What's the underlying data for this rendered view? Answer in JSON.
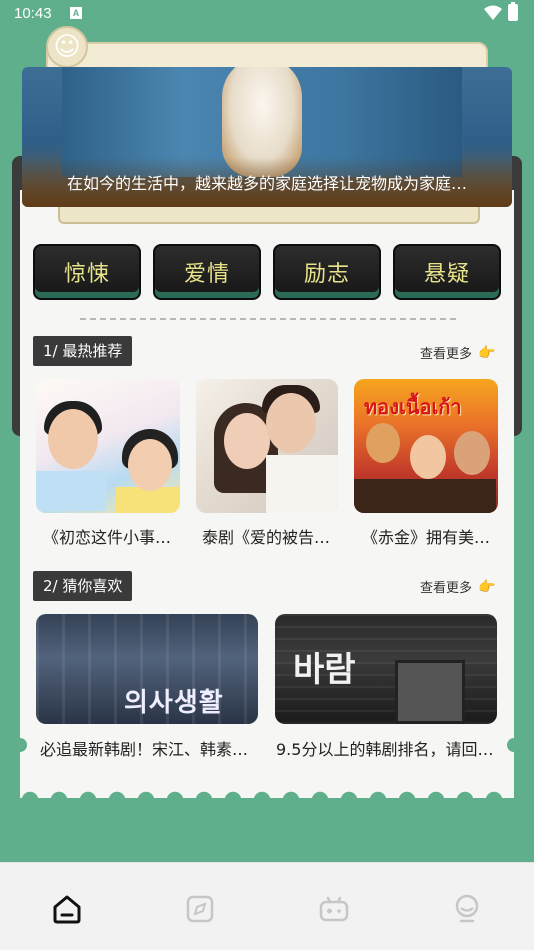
{
  "status": {
    "time": "10:43",
    "notification_icon": "A"
  },
  "banner": {
    "caption": "在如今的生活中，越来越多的家庭选择让宠物成为家庭…",
    "image": "dog-at-door-image"
  },
  "genres": [
    {
      "label": "惊悚"
    },
    {
      "label": "爱情"
    },
    {
      "label": "励志"
    },
    {
      "label": "悬疑"
    }
  ],
  "section_hot": {
    "label": "1/ 最热推荐",
    "more": "查看更多",
    "more_icon": "pointing-hand-icon",
    "items": [
      {
        "caption": "《初恋这件小事…",
        "image": "poster-first-love"
      },
      {
        "caption": "泰剧《爱的被告…",
        "image": "poster-love-defendant"
      },
      {
        "caption": "《赤金》拥有美…",
        "image": "poster-red-gold",
        "poster_title": "ทองเนื้อเก้า"
      }
    ]
  },
  "section_like": {
    "label": "2/ 猜你喜欢",
    "more": "查看更多",
    "more_icon": "pointing-hand-icon",
    "items": [
      {
        "caption": "必追最新韩剧！宋江、韩素…",
        "image": "poster-korean-drama-1",
        "poster_title": "의사생활"
      },
      {
        "caption": "9.5分以上的韩剧排名，请回…",
        "image": "poster-korean-drama-2",
        "poster_title": "바람"
      }
    ]
  },
  "nav": [
    {
      "name": "home",
      "icon": "home-icon",
      "active": true
    },
    {
      "name": "discover",
      "icon": "compass-icon",
      "active": false
    },
    {
      "name": "games",
      "icon": "gamepad-icon",
      "active": false
    },
    {
      "name": "profile",
      "icon": "user-icon",
      "active": false
    }
  ],
  "colors": {
    "background": "#5faf8c",
    "card": "#f6f7f4",
    "genre_text": "#e8e38a",
    "accent": "#f0b429"
  }
}
